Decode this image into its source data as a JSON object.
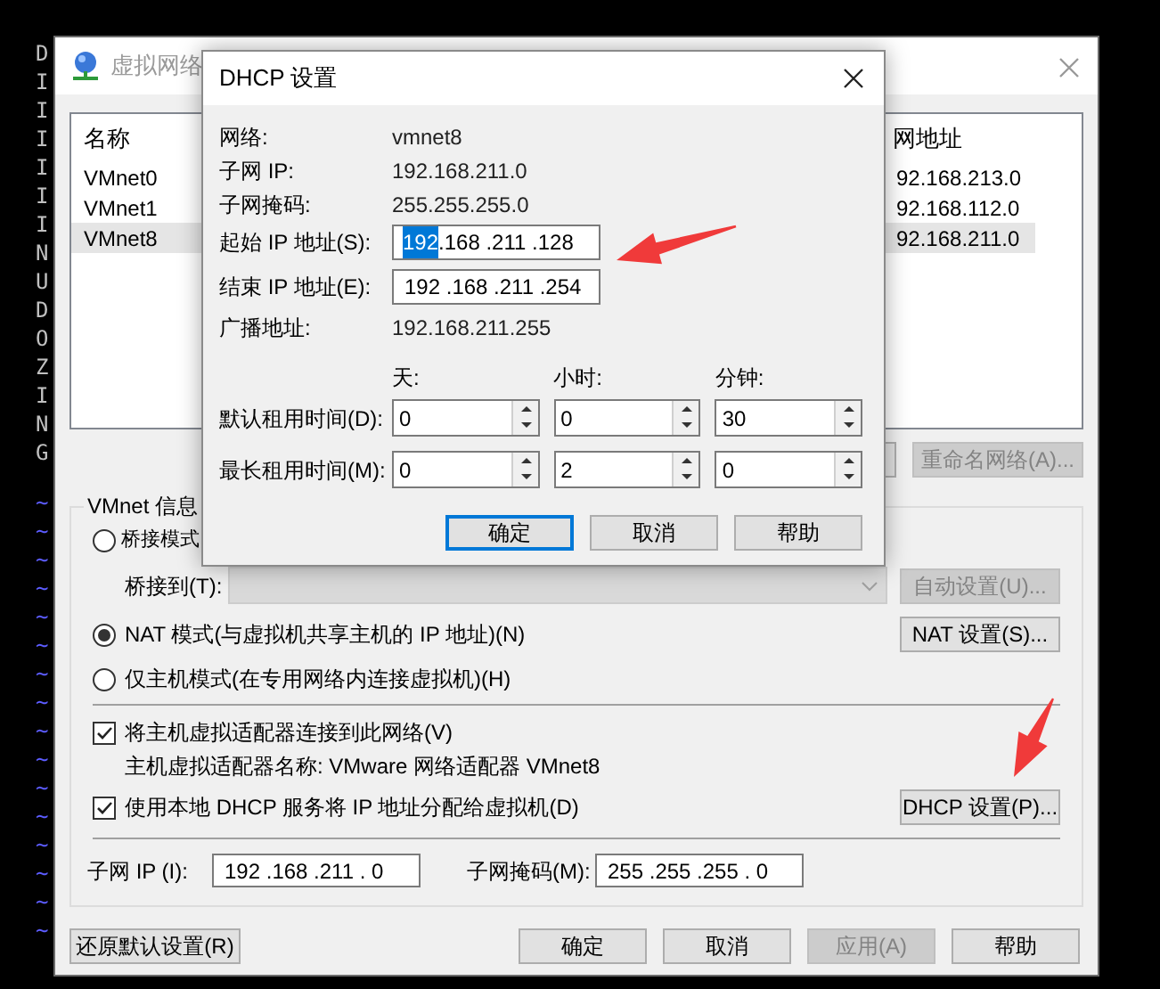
{
  "terminal": {
    "letters": [
      "D",
      "I",
      "I",
      "I",
      "I",
      "I",
      "I",
      "N",
      "U",
      "D",
      "O",
      "Z",
      "I",
      "N",
      "G"
    ],
    "tildes": [
      "~",
      "~",
      "~",
      "~",
      "~",
      "~",
      "~",
      "~",
      "~",
      "~",
      "~",
      "~",
      "~",
      "~",
      "~",
      "~"
    ]
  },
  "main_window": {
    "title": "虚拟网络",
    "network_list": {
      "columns": [
        "名称",
        "网地址"
      ],
      "rows": [
        {
          "name": "VMnet0",
          "subnet": "92.168.213.0",
          "selected": false
        },
        {
          "name": "VMnet1",
          "subnet": "92.168.112.0",
          "selected": false
        },
        {
          "name": "VMnet8",
          "subnet": "92.168.211.0",
          "selected": true
        }
      ]
    },
    "rename_button": {
      "label": "重命名网络(A)...",
      "disabled": true
    },
    "vmnet_info": {
      "title": "VMnet 信息",
      "modes": [
        {
          "label": "桥接模式",
          "selected": false
        },
        {
          "label": "NAT 模式(与虚拟机共享主机的 IP 地址)(N)",
          "selected": true
        },
        {
          "label": "仅主机模式(在专用网络内连接虚拟机)(H)",
          "selected": false
        }
      ],
      "bridge_to": {
        "label": "桥接到(T):",
        "disabled": true
      },
      "auto_button": {
        "label": "自动设置(U)...",
        "disabled": true
      },
      "nat_button": {
        "label": "NAT 设置(S)...",
        "disabled": false
      },
      "connect_adapter": {
        "label": "将主机虚拟适配器连接到此网络(V)",
        "checked": true
      },
      "adapter_name": "主机虚拟适配器名称: VMware 网络适配器 VMnet8",
      "use_dhcp": {
        "label": "使用本地 DHCP 服务将 IP 地址分配给虚拟机(D)",
        "checked": true
      },
      "dhcp_button": {
        "label": "DHCP 设置(P)...",
        "disabled": false
      },
      "subnet_ip": {
        "label": "子网 IP (I):",
        "value": "192 .168 .211 . 0"
      },
      "subnet_mask": {
        "label": "子网掩码(M):",
        "value": "255 .255 .255 . 0"
      }
    },
    "footer_buttons": [
      {
        "label": "还原默认设置(R)",
        "disabled": false
      },
      {
        "label": "确定",
        "disabled": false
      },
      {
        "label": "取消",
        "disabled": false
      },
      {
        "label": "应用(A)",
        "disabled": true
      },
      {
        "label": "帮助",
        "disabled": false
      }
    ]
  },
  "dhcp_dialog": {
    "title": "DHCP 设置",
    "info": [
      {
        "label": "网络:",
        "value": "vmnet8"
      },
      {
        "label": "子网 IP:",
        "value": "192.168.211.0"
      },
      {
        "label": "子网掩码:",
        "value": "255.255.255.0"
      }
    ],
    "start_ip": {
      "label": "起始 IP 地址(S):",
      "value_parts": [
        {
          "text": "192",
          "selected": true
        },
        {
          "text": " .168 .211 .128",
          "selected": false
        }
      ]
    },
    "end_ip": {
      "label": "结束 IP 地址(E):",
      "value": "192 .168 .211 .254"
    },
    "broadcast": {
      "label": "广播地址:",
      "value": "192.168.211.255"
    },
    "lease_columns": [
      "天:",
      "小时:",
      "分钟:"
    ],
    "leases": [
      {
        "label": "默认租用时间(D):",
        "values": [
          "0",
          "0",
          "30"
        ]
      },
      {
        "label": "最长租用时间(M):",
        "values": [
          "0",
          "2",
          "0"
        ]
      }
    ],
    "buttons": [
      {
        "label": "确定",
        "focused": true
      },
      {
        "label": "取消",
        "focused": false
      },
      {
        "label": "帮助",
        "focused": false
      }
    ]
  }
}
